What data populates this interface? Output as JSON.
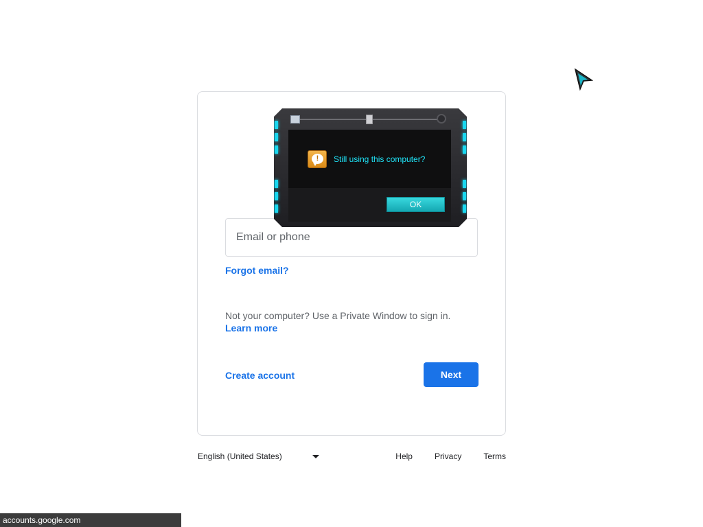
{
  "signin": {
    "email_placeholder": "Email or phone",
    "forgot_email": "Forgot email?",
    "private_note": "Not your computer? Use a Private Window to sign in.",
    "learn_more": "Learn more",
    "create_account": "Create account",
    "next": "Next"
  },
  "footer": {
    "language": "English (United States)",
    "help": "Help",
    "privacy": "Privacy",
    "terms": "Terms"
  },
  "statusbar": {
    "url": "accounts.google.com"
  },
  "dialog": {
    "message": "Still using this computer?",
    "ok": "OK",
    "icon": "warning-speech-bubble-icon",
    "accent": "#19d6ee"
  },
  "colors": {
    "link": "#1a73e8",
    "primary_button": "#1a73e8"
  }
}
